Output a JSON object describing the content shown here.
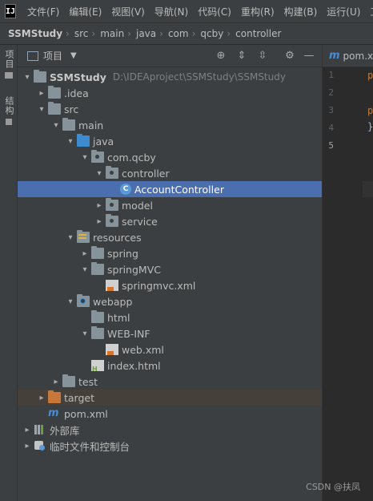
{
  "menubar": {
    "logo": "IJ",
    "items": [
      "文件(F)",
      "编辑(E)",
      "视图(V)",
      "导航(N)",
      "代码(C)",
      "重构(R)",
      "构建(B)",
      "运行(U)",
      "工"
    ]
  },
  "breadcrumbs": [
    "SSMStudy",
    "src",
    "main",
    "java",
    "com",
    "qcby",
    "controller"
  ],
  "left_tool_window": {
    "project_tab": "项目",
    "structure_tab": "结构"
  },
  "project_panel": {
    "title": "项目",
    "tools": [
      "locate-icon",
      "expand-all-icon",
      "collapse-all-icon",
      "settings-icon",
      "hide-icon"
    ]
  },
  "tree": [
    {
      "label": "SSMStudy",
      "path": "D:\\IDEAproject\\SSMStudy\\SSMStudy",
      "depth": 0,
      "arrow": "down",
      "icon": "module-folder",
      "bold": true
    },
    {
      "label": ".idea",
      "depth": 1,
      "arrow": "right",
      "icon": "folder"
    },
    {
      "label": "src",
      "depth": 1,
      "arrow": "down",
      "icon": "folder"
    },
    {
      "label": "main",
      "depth": 2,
      "arrow": "down",
      "icon": "folder"
    },
    {
      "label": "java",
      "depth": 3,
      "arrow": "down",
      "icon": "source-folder"
    },
    {
      "label": "com.qcby",
      "depth": 4,
      "arrow": "down",
      "icon": "package"
    },
    {
      "label": "controller",
      "depth": 5,
      "arrow": "down",
      "icon": "package"
    },
    {
      "label": "AccountController",
      "depth": 6,
      "arrow": "none",
      "icon": "class",
      "selected": true
    },
    {
      "label": "model",
      "depth": 5,
      "arrow": "right",
      "icon": "package"
    },
    {
      "label": "service",
      "depth": 5,
      "arrow": "right",
      "icon": "package"
    },
    {
      "label": "resources",
      "depth": 3,
      "arrow": "down",
      "icon": "resources-folder"
    },
    {
      "label": "spring",
      "depth": 4,
      "arrow": "right",
      "icon": "folder"
    },
    {
      "label": "springMVC",
      "depth": 4,
      "arrow": "down",
      "icon": "folder"
    },
    {
      "label": "springmvc.xml",
      "depth": 5,
      "arrow": "none",
      "icon": "xml"
    },
    {
      "label": "webapp",
      "depth": 3,
      "arrow": "down",
      "icon": "web-folder"
    },
    {
      "label": "html",
      "depth": 4,
      "arrow": "none",
      "icon": "folder"
    },
    {
      "label": "WEB-INF",
      "depth": 4,
      "arrow": "down",
      "icon": "folder"
    },
    {
      "label": "web.xml",
      "depth": 5,
      "arrow": "none",
      "icon": "xml"
    },
    {
      "label": "index.html",
      "depth": 4,
      "arrow": "none",
      "icon": "html"
    },
    {
      "label": "test",
      "depth": 2,
      "arrow": "right",
      "icon": "folder"
    },
    {
      "label": "target",
      "depth": 1,
      "arrow": "right",
      "icon": "excluded-folder",
      "excluded": true
    },
    {
      "label": "pom.xml",
      "depth": 1,
      "arrow": "none",
      "icon": "maven"
    },
    {
      "label": "外部库",
      "depth": 0,
      "arrow": "right",
      "icon": "library"
    },
    {
      "label": "临时文件和控制台",
      "depth": 0,
      "arrow": "right",
      "icon": "scratch"
    }
  ],
  "editor": {
    "tab_icon": "m",
    "tab_label": "pom.x",
    "line_numbers": [
      "1",
      "2",
      "3",
      "4",
      "5"
    ],
    "active_line": "5",
    "code_fragments": [
      "p",
      "",
      "p",
      "}",
      ""
    ]
  },
  "watermark": "CSDN @扶凤"
}
